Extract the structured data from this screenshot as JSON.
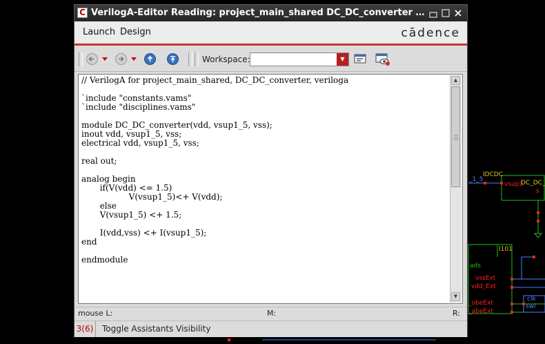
{
  "window": {
    "title": "VerilogA-Editor Reading: project_main_shared DC_DC_converter verilog",
    "app_icon_letter": "C",
    "minimize_glyph": "▫",
    "maximize_glyph": "▫",
    "close_glyph": "✕"
  },
  "menu": {
    "items": [
      "Launch",
      "Design"
    ],
    "brand": "cādence"
  },
  "toolbar": {
    "workspace_label": "Workspace:",
    "workspace_value": ""
  },
  "editor": {
    "code": "// VerilogA for project_main_shared, DC_DC_converter, veriloga\n\n`include \"constants.vams\"\n`include \"disciplines.vams\"\n\nmodule DC_DC_converter(vdd, vsup1_5, vss);\ninout vdd, vsup1_5, vss;\nelectrical vdd, vsup1_5, vss;\n\nreal out;\n\nanalog begin\n       if(V(vdd) <= 1.5)\n                  V(vsup1_5)<+ V(vdd);\n       else\n       V(vsup1_5) <+ 1.5;\n\n       I(vdd,vss) <+ I(vsup1_5);\nend\n\nendmodule"
  },
  "mouse_bar": {
    "left": "mouse L:",
    "middle": "M:",
    "right": "R:"
  },
  "status": {
    "count": "3(6)",
    "message": "Toggle Assistants Visibility"
  },
  "background": {
    "labels": {
      "net_1_5": "_1_5",
      "inst_dcdc": "IDCDC",
      "pin_vsup": "vsup1",
      "cell_name": "DC_DC_",
      "inst_i01": "I101",
      "ads": "ads",
      "vssExt": "vssExt",
      "vdd_Ext": "vdd_Ext",
      "pin_clk": "clk",
      "pin_swl": "swl",
      "obeExt_1": "_obeExt",
      "obeExt_2": "_abeExt",
      "pin_s": "s"
    }
  },
  "colors": {
    "accent": "#c0392b",
    "schematic_green": "#20c020",
    "schematic_red": "#ff2020"
  }
}
